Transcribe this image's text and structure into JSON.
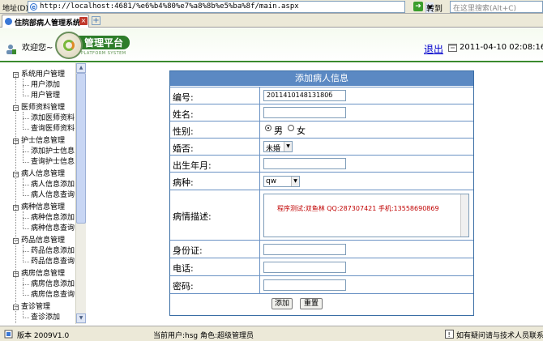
{
  "browser": {
    "address_label": "地址(D)",
    "url": "http://localhost:4681/%e6%b4%80%e7%a8%8b%e5%ba%8f/main.aspx",
    "go_label": "转到",
    "search_placeholder": "在这里搜索(Alt+C)",
    "tab_title": "住院部病人管理系统"
  },
  "header": {
    "welcome": "欢迎您~",
    "logo_title": "管理平台",
    "logo_subtitle": "PLATFORM SYSTEM",
    "logout": "退出",
    "datetime": "2011-04-10 02:08:16 PM"
  },
  "sidebar": {
    "groups": [
      {
        "label": "系统用户管理",
        "items": [
          "用户添加",
          "用户管理"
        ]
      },
      {
        "label": "医师资料管理",
        "items": [
          "添加医师资料",
          "查询医师资料"
        ]
      },
      {
        "label": "护士信息管理",
        "items": [
          "添加护士信息",
          "查询护士信息"
        ]
      },
      {
        "label": "病人信息管理",
        "items": [
          "病人信息添加",
          "病人信息查询"
        ]
      },
      {
        "label": "病种信息管理",
        "items": [
          "病种信息添加",
          "病种信息查询"
        ]
      },
      {
        "label": "药品信息管理",
        "items": [
          "药品信息添加",
          "药品信息查询"
        ]
      },
      {
        "label": "病房信息管理",
        "items": [
          "病房信息添加",
          "病房信息查询"
        ]
      },
      {
        "label": "查诊管理",
        "items": [
          "查诊添加"
        ]
      }
    ]
  },
  "form": {
    "title": "添加病人信息",
    "id_label": "编号:",
    "id_value": "201141014813180б",
    "name_label": "姓名:",
    "name_value": "",
    "gender_label": "性别:",
    "gender_male": "男",
    "gender_female": "女",
    "gender_selected": "男",
    "married_label": "婚否:",
    "married_value": "未婚",
    "birth_label": "出生年月:",
    "birth_value": "",
    "disease_label": "病种:",
    "disease_value": "qw",
    "desc_label": "病情描述:",
    "desc_value": "程序测试:双鱼林 QQ:287307421 手机:13558690869",
    "idcard_label": "身份证:",
    "phone_label": "电话:",
    "password_label": "密码:",
    "add_button": "添加",
    "reset_button": "重置"
  },
  "status": {
    "version": "版本 2009V1.0",
    "current_user": "当前用户:hsg 角色:超级管理员",
    "help": "如有疑问请与技术人员联系"
  },
  "colors": {
    "header_green": "#2e7d2a",
    "form_header_blue": "#5b89c3",
    "description_red": "#c00000",
    "link_blue": "#0000cc"
  }
}
